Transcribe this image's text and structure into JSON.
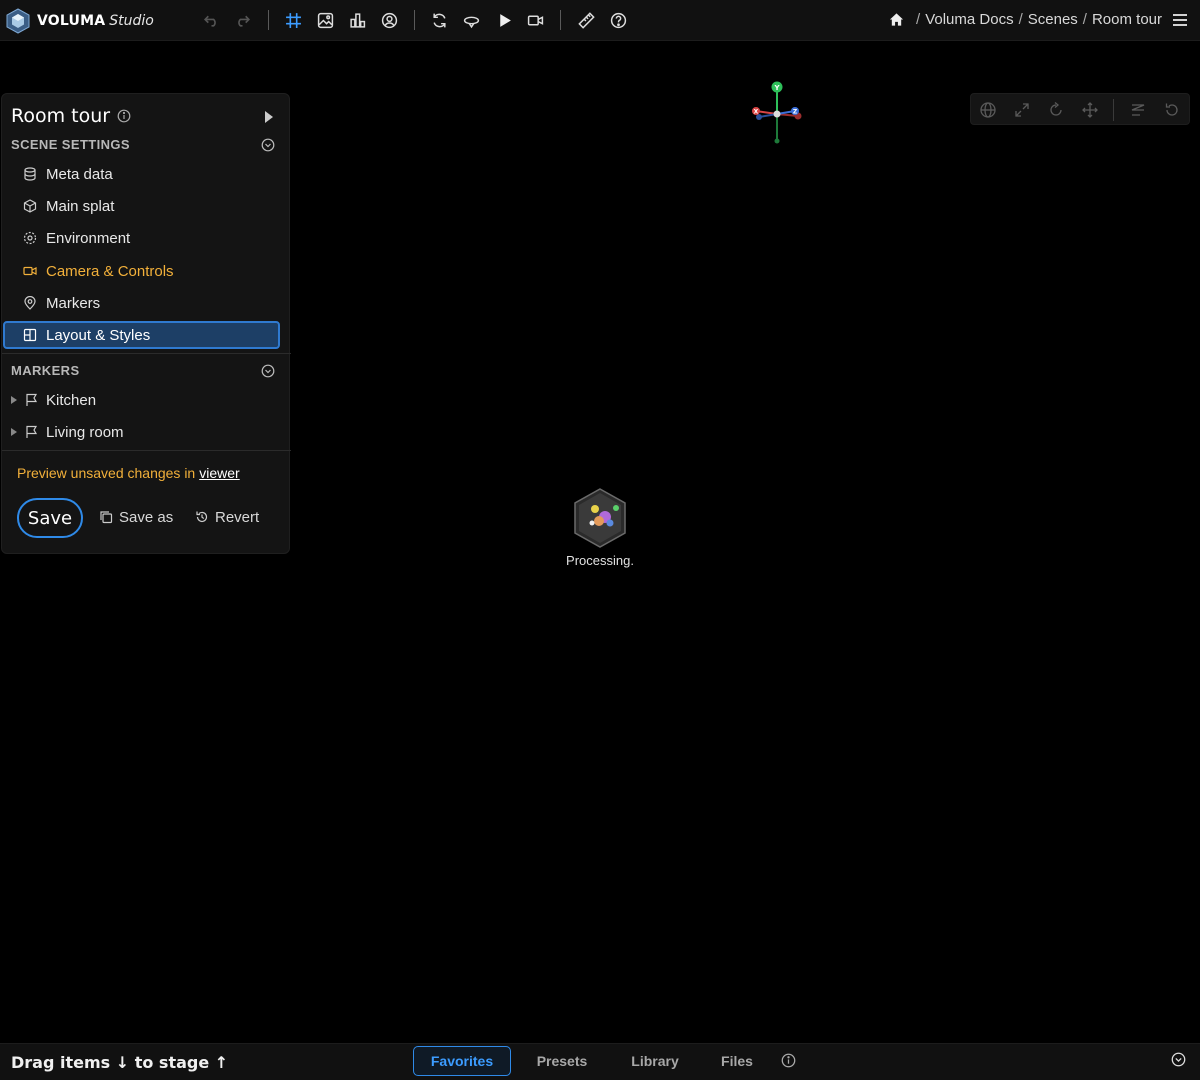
{
  "app": {
    "brand": "VOLUMA",
    "brand_sub": "Studio"
  },
  "toolbar": {
    "icons": [
      "undo-icon",
      "redo-icon",
      "grid-icon",
      "image-icon",
      "chart-icon",
      "avatar-icon",
      "refresh-icon",
      "orbit-icon",
      "play-icon",
      "camera-icon",
      "ruler-icon",
      "help-icon"
    ],
    "accent": "#3c9cff"
  },
  "breadcrumb": {
    "items": [
      "Voluma Docs",
      "Scenes",
      "Room tour"
    ],
    "separator": "/"
  },
  "panel": {
    "title": "Room tour",
    "scene_settings_header": "SCENE SETTINGS",
    "items": [
      {
        "label": "Meta data",
        "icon": "database-icon"
      },
      {
        "label": "Main splat",
        "icon": "cube-icon"
      },
      {
        "label": "Environment",
        "icon": "environment-icon"
      },
      {
        "label": "Camera & Controls",
        "icon": "camera-icon",
        "state": "active"
      },
      {
        "label": "Markers",
        "icon": "pin-icon"
      },
      {
        "label": "Layout & Styles",
        "icon": "layout-icon",
        "state": "selected"
      }
    ],
    "markers_header": "MARKERS",
    "markers": [
      {
        "label": "Kitchen",
        "icon": "flag-icon"
      },
      {
        "label": "Living room",
        "icon": "flag-icon"
      }
    ],
    "preview_note": "Preview unsaved changes in",
    "preview_link": "viewer",
    "save_label": "Save",
    "save_as_label": "Save as",
    "revert_label": "Revert",
    "colors": {
      "active": "#f2b03a",
      "selected_bg": "#1d3f66",
      "selected_border": "#2f7ad0"
    }
  },
  "gizmo": {
    "labels": {
      "y": "Y",
      "x": "X",
      "z": "Z"
    }
  },
  "viewport_toolbar": {
    "icons": [
      "globe-icon",
      "expand-icon",
      "rotate-icon",
      "move-icon",
      "align-icon",
      "reset-icon"
    ]
  },
  "status": {
    "processing_text": "Processing."
  },
  "bottom": {
    "drag_hint": "Drag items ↓ to stage ↑",
    "tabs": [
      {
        "label": "Favorites",
        "active": true
      },
      {
        "label": "Presets",
        "active": false
      },
      {
        "label": "Library",
        "active": false
      },
      {
        "label": "Files",
        "active": false
      }
    ]
  }
}
